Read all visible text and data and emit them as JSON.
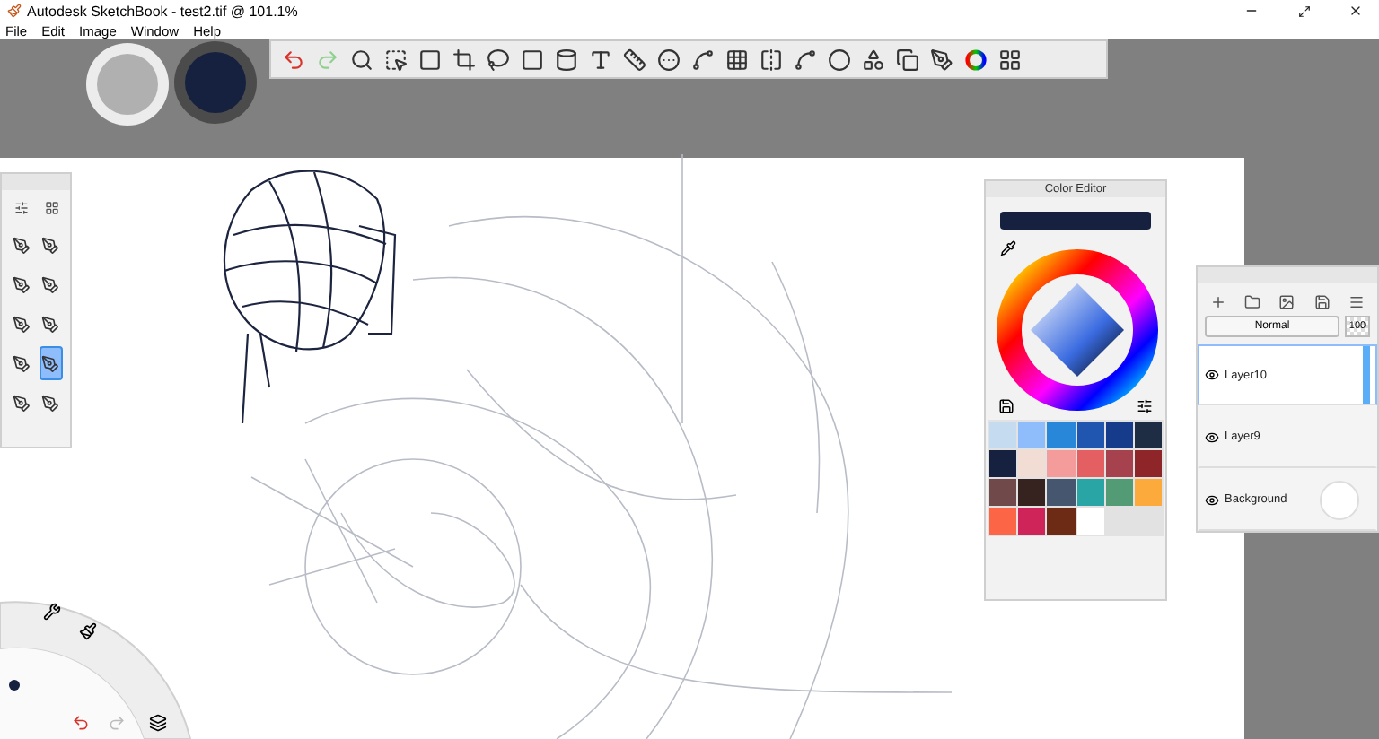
{
  "window": {
    "title": "Autodesk SketchBook - test2.tif @ 101.1%"
  },
  "menu": [
    "File",
    "Edit",
    "Image",
    "Window",
    "Help"
  ],
  "brushes": [
    {
      "selected": false
    },
    {
      "selected": false
    },
    {
      "selected": false
    },
    {
      "selected": false
    },
    {
      "selected": false
    },
    {
      "selected": false
    },
    {
      "selected": false
    },
    {
      "selected": true
    },
    {
      "selected": false
    },
    {
      "selected": false
    }
  ],
  "color_editor": {
    "title": "Color Editor",
    "current_color": {
      "color": "#16213f"
    },
    "swatches": [
      {
        "color": "#c5dcf0"
      },
      {
        "color": "#8fbdfb"
      },
      {
        "color": "#2887d8"
      },
      {
        "color": "#2055b0"
      },
      {
        "color": "#163b8a"
      },
      {
        "color": "#1f2d44"
      },
      {
        "color": "#16213f"
      },
      {
        "color": "#f1ddd3"
      },
      {
        "color": "#f49b9c"
      },
      {
        "color": "#e35f62"
      },
      {
        "color": "#a5424d"
      },
      {
        "color": "#8e2629"
      },
      {
        "color": "#704a4a"
      },
      {
        "color": "#36231f"
      },
      {
        "color": "#45566e"
      },
      {
        "color": "#2aa5a6"
      },
      {
        "color": "#529b74"
      },
      {
        "color": "#fdaa3c"
      },
      {
        "color": "#fc6545"
      },
      {
        "color": "#cf2459"
      },
      {
        "color": "#6d2a15"
      },
      {
        "color": "#ffffff"
      }
    ]
  },
  "layers": {
    "blend_mode": "Normal",
    "opacity": "100",
    "items": [
      {
        "name": "Layer10",
        "selected": true,
        "visible": true
      },
      {
        "name": "Layer9",
        "selected": false,
        "visible": true
      },
      {
        "name": "Background",
        "selected": false,
        "visible": true
      }
    ]
  }
}
